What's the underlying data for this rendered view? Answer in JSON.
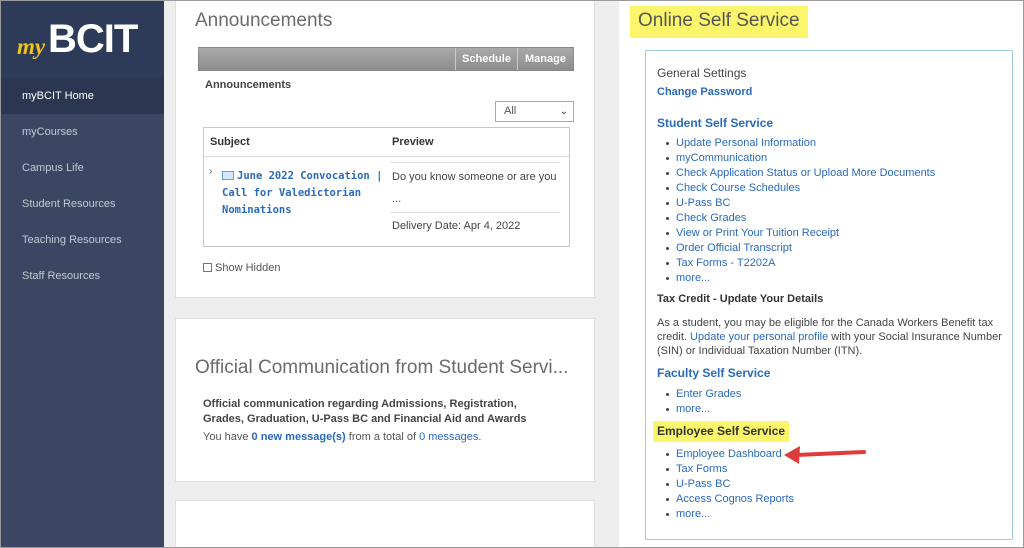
{
  "logo": {
    "my": "my",
    "bcit": "BCIT"
  },
  "sidebar": {
    "items": [
      {
        "label": "myBCIT Home"
      },
      {
        "label": "myCourses"
      },
      {
        "label": "Campus Life"
      },
      {
        "label": "Student Resources"
      },
      {
        "label": "Teaching Resources"
      },
      {
        "label": "Staff Resources"
      }
    ]
  },
  "announcements": {
    "title": "Announcements",
    "toolbar": {
      "schedule": "Schedule",
      "manage": "Manage"
    },
    "subtitle": "Announcements",
    "filter": {
      "selected": "All"
    },
    "columns": {
      "subject": "Subject",
      "preview": "Preview"
    },
    "item": {
      "subject": "June 2022 Convocation | Call for Valedictorian Nominations",
      "preview": "Do you know someone or are you",
      "ellipsis": "...",
      "delivery": "Delivery Date: Apr 4, 2022"
    },
    "show_hidden": "Show Hidden"
  },
  "official": {
    "title": "Official Communication from Student Servi...",
    "description": "Official communication regarding Admissions, Registration, Grades, Graduation, U-Pass BC and Financial Aid and Awards",
    "msg_prefix": "You have",
    "msg_new": "0 new message(s)",
    "msg_mid": "from a total of",
    "msg_total": "0 messages",
    "msg_end": "."
  },
  "oss": {
    "title": "Online Self Service",
    "general_settings": "General Settings",
    "change_password": "Change Password",
    "student": {
      "title": "Student Self Service",
      "links": [
        "Update Personal Information",
        "myCommunication",
        "Check Application Status or Upload More Documents",
        "Check Course Schedules",
        "U-Pass BC",
        "Check Grades",
        "View or Print Your Tuition Receipt",
        "Order Official Transcript",
        "Tax Forms - T2202A",
        "more..."
      ]
    },
    "tax_credit": {
      "title": "Tax Credit - Update Your Details",
      "text1": "As a student, you may be eligible for the Canada Workers Benefit tax credit.",
      "link": "Update your personal profile",
      "text2": "with your Social Insurance Number (SIN) or Individual Taxation Number (ITN)."
    },
    "faculty": {
      "title": "Faculty Self Service",
      "links": [
        "Enter Grades",
        "more..."
      ]
    },
    "employee": {
      "title": "Employee Self Service",
      "links": [
        "Employee Dashboard",
        "Tax Forms",
        "U-Pass BC",
        "Access Cognos Reports",
        "more..."
      ]
    }
  },
  "colors": {
    "highlight": "#fbf56b",
    "sidebar": "#3b4762",
    "link": "#2a6ab8",
    "arrow": "#e03b3b"
  }
}
